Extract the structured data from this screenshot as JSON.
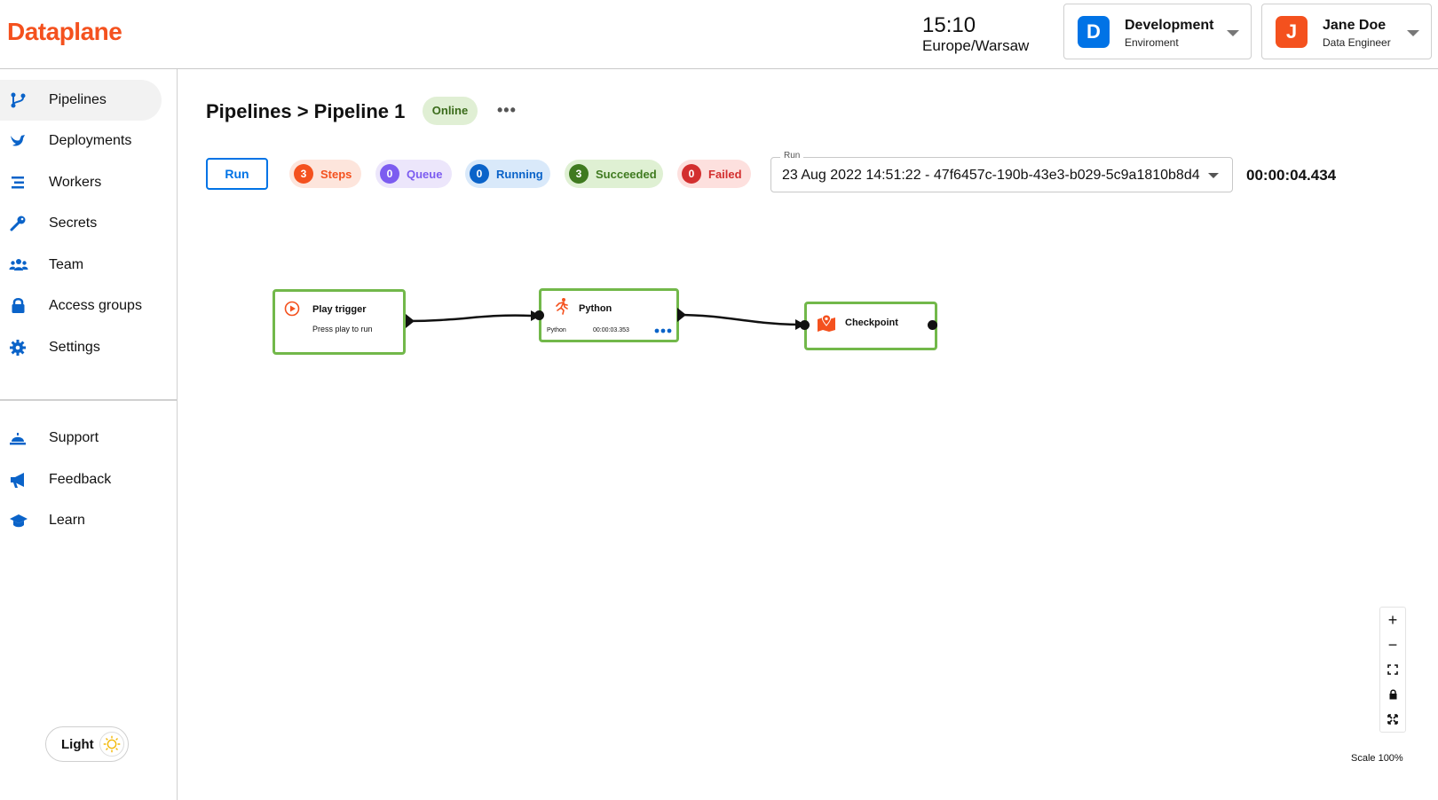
{
  "app": {
    "logo": "Dataplane"
  },
  "header": {
    "time": "15:10",
    "timezone": "Europe/Warsaw",
    "environment": {
      "initial": "D",
      "name": "Development",
      "label": "Enviroment",
      "color": "#0073e6"
    },
    "user": {
      "initial": "J",
      "name": "Jane Doe",
      "role": "Data Engineer",
      "color": "#f4511e"
    }
  },
  "sidebar": {
    "items": [
      {
        "label": "Pipelines",
        "icon": "pipeline-icon",
        "active": true
      },
      {
        "label": "Deployments",
        "icon": "bird-icon"
      },
      {
        "label": "Workers",
        "icon": "list-icon"
      },
      {
        "label": "Secrets",
        "icon": "key-icon"
      },
      {
        "label": "Team",
        "icon": "people-icon"
      },
      {
        "label": "Access groups",
        "icon": "lock-icon"
      },
      {
        "label": "Settings",
        "icon": "gear-icon"
      }
    ],
    "secondary": [
      {
        "label": "Support",
        "icon": "bell-icon"
      },
      {
        "label": "Feedback",
        "icon": "megaphone-icon"
      },
      {
        "label": "Learn",
        "icon": "graduation-cap-icon"
      }
    ],
    "theme": {
      "label": "Light",
      "icon": "sun-icon"
    }
  },
  "main": {
    "breadcrumb": "Pipelines > Pipeline 1",
    "status": "Online",
    "more": "•••",
    "run_button": "Run",
    "stats": {
      "steps": {
        "count": "3",
        "label": "Steps"
      },
      "queue": {
        "count": "0",
        "label": "Queue"
      },
      "running": {
        "count": "0",
        "label": "Running"
      },
      "succeeded": {
        "count": "3",
        "label": "Succeeded"
      },
      "failed": {
        "count": "0",
        "label": "Failed"
      }
    },
    "run_select": {
      "legend": "Run",
      "value": "23 Aug 2022 14:51:22 - 47f6457c-190b-43e3-b029-5c9a1810b8d4"
    },
    "elapsed": "00:00:04.434"
  },
  "canvas": {
    "nodes": {
      "trigger": {
        "title": "Play trigger",
        "desc": "Press play to run",
        "icon": "play-circle-icon"
      },
      "python": {
        "title": "Python",
        "type": "Python",
        "duration": "00:00:03.353",
        "icon": "running-person-icon"
      },
      "checkpoint": {
        "title": "Checkpoint",
        "icon": "map-pin-icon"
      }
    },
    "controls": {
      "zoom_in": "+",
      "zoom_out": "−"
    },
    "scale": "Scale 100%"
  }
}
